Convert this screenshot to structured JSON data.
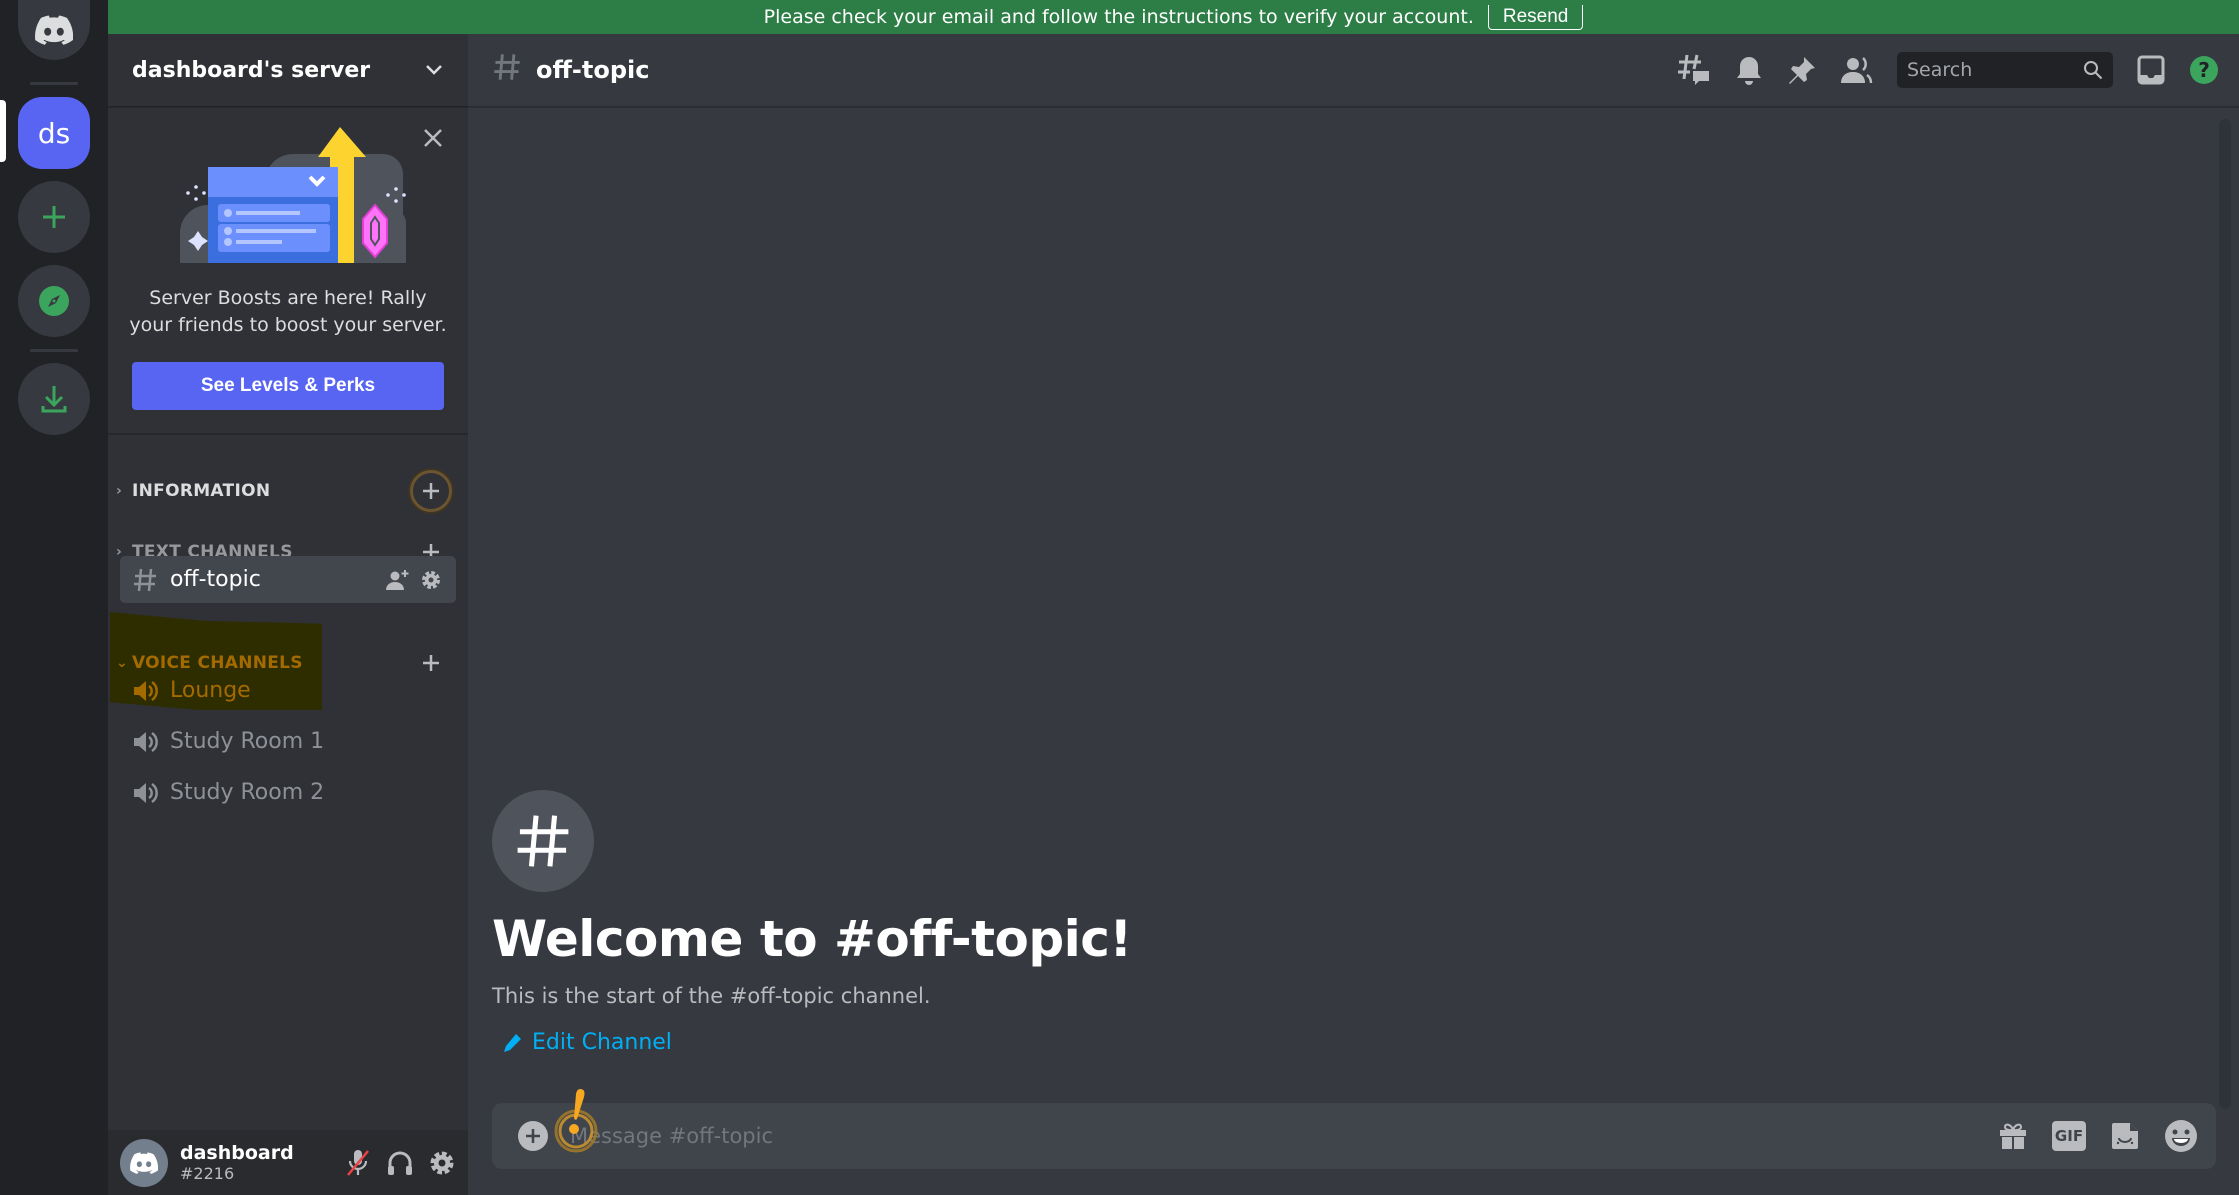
{
  "banner": {
    "message": "Please check your email and follow the instructions to verify your account.",
    "resend_label": "Resend",
    "color": "#2d7d46"
  },
  "rail": {
    "home_icon": "discord-logo-icon",
    "servers": [
      {
        "label": "ds",
        "active": true,
        "color": "#5865f2"
      }
    ],
    "add_server_icon": "plus-icon",
    "explore_icon": "compass-icon",
    "download_icon": "download-icon"
  },
  "server": {
    "name": "dashboard's server",
    "boost": {
      "text": "Server Boosts are here! Rally your friends to boost your server.",
      "button_label": "See Levels & Perks"
    },
    "categories": [
      {
        "name": "INFORMATION",
        "expanded": false
      },
      {
        "name": "TEXT CHANNELS",
        "expanded": false,
        "channels": [
          {
            "name": "off-topic",
            "type": "text",
            "selected": true
          }
        ]
      },
      {
        "name": "VOICE CHANNELS",
        "expanded": true,
        "channels": [
          {
            "name": "Lounge",
            "type": "voice"
          },
          {
            "name": "Study Room 1",
            "type": "voice"
          },
          {
            "name": "Study Room 2",
            "type": "voice"
          }
        ]
      }
    ]
  },
  "user": {
    "name": "dashboard",
    "tag": "#2216",
    "muted": true
  },
  "channel": {
    "name": "off-topic",
    "search_placeholder": "Search",
    "welcome_title": "Welcome to #off-topic!",
    "welcome_subtitle": "This is the start of the #off-topic channel.",
    "edit_label": "Edit Channel",
    "message_placeholder": "Message #off-topic",
    "gif_label": "GIF"
  },
  "colors": {
    "accent": "#5865f2",
    "link": "#00aff4",
    "green": "#3ba55d",
    "highlight_text": "#a36a00"
  }
}
